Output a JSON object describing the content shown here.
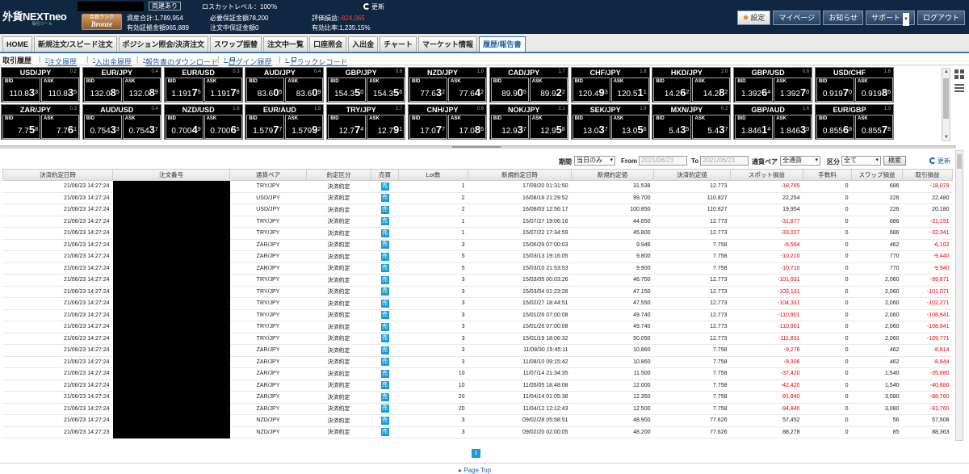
{
  "header": {
    "logo_text": "外貨NEXTneo",
    "logo_sub": "取引ツール",
    "one_click": "両建あり",
    "loss_cut": "ロスカットレベル：100％",
    "refresh": "更新",
    "rank_label": "会員ランク",
    "rank": "Bronze",
    "stats": {
      "total_assets": "資産合計:1,789,954",
      "valid_margin": "有効証拠金額965,889",
      "req_margin": "必要保証金額78,200",
      "order_margin": "注文中保証金額0",
      "eval_label": "評価損益:",
      "eval_value": "-824,065",
      "ratio": "有効比率:1,235.15%"
    },
    "buttons": {
      "settings": "設定",
      "mypage": "マイページ",
      "notice": "お知らせ",
      "support": "サポート",
      "logout": "ログアウト"
    }
  },
  "nav": {
    "tabs": [
      "HOME",
      "新規注文/スピード注文",
      "ポジション照会/決済注文",
      "スワップ振替",
      "注文中一覧",
      "口座照会",
      "入出金",
      "チャート",
      "マーケット情報",
      "履歴/報告書"
    ],
    "active": "履歴/報告書"
  },
  "subnav": {
    "items": [
      "取引履歴",
      "注文履歴",
      "入出金履歴",
      "報告書のダウンロード",
      "ログイン履歴",
      "トラックレコード"
    ]
  },
  "rate_labels": {
    "bid": "BID",
    "ask": "ASK"
  },
  "rates": [
    {
      "pair": "USD/JPY",
      "spread": "0.2",
      "bid": [
        "110.8",
        "3",
        "3"
      ],
      "ask": [
        "110.8",
        "3",
        "5"
      ]
    },
    {
      "pair": "EUR/JPY",
      "spread": "0.4",
      "bid": [
        "132.0",
        "8",
        "5"
      ],
      "ask": [
        "132.0",
        "8",
        "9"
      ]
    },
    {
      "pair": "EUR/USD",
      "spread": "0.3",
      "bid": [
        "1.191",
        "7",
        "5"
      ],
      "ask": [
        "1.191",
        "7",
        "8"
      ]
    },
    {
      "pair": "AUD/JPY",
      "spread": "0.4",
      "bid": [
        "83.6",
        "0",
        "5"
      ],
      "ask": [
        "83.6",
        "0",
        "9"
      ]
    },
    {
      "pair": "GBP/JPY",
      "spread": "0.6",
      "bid": [
        "154.3",
        "5",
        "0"
      ],
      "ask": [
        "154.3",
        "5",
        "6"
      ]
    },
    {
      "pair": "NZD/JPY",
      "spread": "1.0",
      "bid": [
        "77.6",
        "3",
        "2"
      ],
      "ask": [
        "77.6",
        "4",
        "2"
      ]
    },
    {
      "pair": "CAD/JPY",
      "spread": "1.7",
      "bid": [
        "89.9",
        "0",
        "5"
      ],
      "ask": [
        "89.9",
        "2",
        "2"
      ]
    },
    {
      "pair": "CHF/JPY",
      "spread": "1.8",
      "bid": [
        "120.4",
        "9",
        "3"
      ],
      "ask": [
        "120.5",
        "1",
        "1"
      ]
    },
    {
      "pair": "HKD/JPY",
      "spread": "2.0",
      "bid": [
        "14.2",
        "6",
        "2"
      ],
      "ask": [
        "14.2",
        "8",
        "2"
      ]
    },
    {
      "pair": "GBP/USD",
      "spread": "0.6",
      "bid": [
        "1.392",
        "6",
        "4"
      ],
      "ask": [
        "1.392",
        "7",
        "0"
      ]
    },
    {
      "pair": "USD/CHF",
      "spread": "1.6",
      "bid": [
        "0.919",
        "7",
        "0"
      ],
      "ask": [
        "0.919",
        "8",
        "6"
      ]
    },
    {
      "pair": "ZAR/JPY",
      "spread": "0.3",
      "bid": [
        "7.7",
        "5",
        "8"
      ],
      "ask": [
        "7.7",
        "6",
        "1"
      ]
    },
    {
      "pair": "AUD/USD",
      "spread": "0.4",
      "bid": [
        "0.754",
        "3",
        "3"
      ],
      "ask": [
        "0.754",
        "3",
        "7"
      ]
    },
    {
      "pair": "NZD/USD",
      "spread": "1.6",
      "bid": [
        "0.700",
        "4",
        "9"
      ],
      "ask": [
        "0.700",
        "6",
        "5"
      ]
    },
    {
      "pair": "EUR/AUD",
      "spread": "1.5",
      "bid": [
        "1.579",
        "7",
        "7"
      ],
      "ask": [
        "1.579",
        "9",
        "2"
      ]
    },
    {
      "pair": "TRY/JPY",
      "spread": "1.7",
      "bid": [
        "12.7",
        "7",
        "4"
      ],
      "ask": [
        "12.7",
        "9",
        "1"
      ]
    },
    {
      "pair": "CNH/JPY",
      "spread": "0.9",
      "bid": [
        "17.0",
        "7",
        "7"
      ],
      "ask": [
        "17.0",
        "8",
        "6"
      ]
    },
    {
      "pair": "NOK/JPY",
      "spread": "2.1",
      "bid": [
        "12.9",
        "3",
        "7"
      ],
      "ask": [
        "12.9",
        "5",
        "8"
      ]
    },
    {
      "pair": "SEK/JPY",
      "spread": "1.9",
      "bid": [
        "13.0",
        "3",
        "7"
      ],
      "ask": [
        "13.0",
        "5",
        "6"
      ]
    },
    {
      "pair": "MXN/JPY",
      "spread": "0.2",
      "bid": [
        "5.4",
        "3",
        "5"
      ],
      "ask": [
        "5.4",
        "3",
        "7"
      ]
    },
    {
      "pair": "GBP/AUD",
      "spread": "1.6",
      "bid": [
        "1.846",
        "1",
        "4"
      ],
      "ask": [
        "1.846",
        "3",
        "0"
      ]
    },
    {
      "pair": "EUR/GBP",
      "spread": "1.0",
      "bid": [
        "0.855",
        "6",
        "8"
      ],
      "ask": [
        "0.855",
        "7",
        "8"
      ]
    }
  ],
  "filters": {
    "period_label": "期間",
    "period_value": "当日のみ",
    "from_label": "From",
    "from_value": "2021/06/23",
    "to_label": "To",
    "to_value": "2021/06/23",
    "pair_label": "通貨ペア",
    "pair_value": "全通貨",
    "type_label": "区分",
    "type_value": "全て",
    "search": "検索",
    "refresh": "更新"
  },
  "table": {
    "headers": [
      "決済約定日時",
      "注文番号",
      "通貨ペア",
      "約定区分",
      "売買",
      "Lot数",
      "新規約定日時",
      "新規約定値",
      "決済約定値",
      "スポット損益",
      "手数料",
      "スワップ損益",
      "取引損益"
    ],
    "side_text": "売",
    "rows": [
      [
        "21/06/23 14:27:24",
        "TRY/JPY",
        "決済約定",
        "1",
        "17/09/20 01:31:50",
        "31.538",
        "12.773",
        "-18,765",
        "0",
        "686",
        "-18,079"
      ],
      [
        "21/06/23 14:27:24",
        "USD/JPY",
        "決済約定",
        "2",
        "16/08/16 21:29:52",
        "99.700",
        "110.827",
        "22,254",
        "0",
        "226",
        "22,480"
      ],
      [
        "21/06/23 14:27:24",
        "USD/JPY",
        "決済約定",
        "2",
        "16/08/03 12:56:17",
        "100.850",
        "110.827",
        "19,954",
        "0",
        "226",
        "20,180"
      ],
      [
        "21/06/23 14:27:24",
        "TRY/JPY",
        "決済約定",
        "1",
        "15/07/27 19:06:16",
        "44.650",
        "12.773",
        "-31,877",
        "0",
        "686",
        "-31,191"
      ],
      [
        "21/06/23 14:27:24",
        "TRY/JPY",
        "決済約定",
        "1",
        "15/07/22 17:34:59",
        "45.800",
        "12.773",
        "-33,027",
        "0",
        "686",
        "-32,341"
      ],
      [
        "21/06/23 14:27:24",
        "ZAR/JPY",
        "決済約定",
        "3",
        "15/06/29 07:00:03",
        "9.946",
        "7.758",
        "-6,564",
        "0",
        "462",
        "-6,102"
      ],
      [
        "21/06/23 14:27:24",
        "ZAR/JPY",
        "決済約定",
        "5",
        "15/03/13 19:16:05",
        "9.800",
        "7.758",
        "-10,210",
        "0",
        "770",
        "-9,440"
      ],
      [
        "21/06/23 14:27:24",
        "ZAR/JPY",
        "決済約定",
        "5",
        "15/03/10 21:53:53",
        "9.900",
        "7.758",
        "-10,710",
        "0",
        "770",
        "-9,940"
      ],
      [
        "21/06/23 14:27:24",
        "TRY/JPY",
        "決済約定",
        "3",
        "15/03/05 00:03:26",
        "46.750",
        "12.773",
        "-101,931",
        "0",
        "2,060",
        "-99,871"
      ],
      [
        "21/06/23 14:27:24",
        "TRY/JPY",
        "決済約定",
        "3",
        "15/03/04 01:23:28",
        "47.150",
        "12.773",
        "-103,131",
        "0",
        "2,060",
        "-101,071"
      ],
      [
        "21/06/23 14:27:24",
        "TRY/JPY",
        "決済約定",
        "3",
        "15/02/27 18:44:51",
        "47.550",
        "12.773",
        "-104,331",
        "0",
        "2,060",
        "-102,271"
      ],
      [
        "21/06/23 14:27:24",
        "TRY/JPY",
        "決済約定",
        "3",
        "15/01/26 07:00:08",
        "49.740",
        "12.773",
        "-110,901",
        "0",
        "2,060",
        "-108,841"
      ],
      [
        "21/06/23 14:27:24",
        "TRY/JPY",
        "決済約定",
        "3",
        "15/01/26 07:00:08",
        "49.740",
        "12.773",
        "-110,901",
        "0",
        "2,060",
        "-108,841"
      ],
      [
        "21/06/23 14:27:24",
        "TRY/JPY",
        "決済約定",
        "3",
        "15/01/19 18:06:32",
        "50.050",
        "12.773",
        "-111,831",
        "0",
        "2,060",
        "-109,771"
      ],
      [
        "21/06/23 14:27:24",
        "ZAR/JPY",
        "決済約定",
        "3",
        "11/08/30 15:45:11",
        "10.860",
        "7.758",
        "-9,276",
        "0",
        "462",
        "-8,814"
      ],
      [
        "21/06/23 14:27:24",
        "ZAR/JPY",
        "決済約定",
        "3",
        "11/08/10 09:15:42",
        "10.860",
        "7.758",
        "-9,306",
        "0",
        "462",
        "-8,844"
      ],
      [
        "21/06/23 14:27:24",
        "ZAR/JPY",
        "決済約定",
        "10",
        "11/07/14 21:34:35",
        "11.500",
        "7.758",
        "-37,420",
        "0",
        "1,540",
        "-35,880"
      ],
      [
        "21/06/23 14:27:24",
        "ZAR/JPY",
        "決済約定",
        "10",
        "11/05/05 18:48:08",
        "12.000",
        "7.758",
        "-42,420",
        "0",
        "1,540",
        "-40,880"
      ],
      [
        "21/06/23 14:27:24",
        "ZAR/JPY",
        "決済約定",
        "20",
        "11/04/14 01:05:38",
        "12.350",
        "7.758",
        "-91,840",
        "0",
        "3,080",
        "-88,760"
      ],
      [
        "21/06/23 14:27:24",
        "ZAR/JPY",
        "決済約定",
        "20",
        "11/04/12 12:12:43",
        "12.500",
        "7.758",
        "-94,840",
        "0",
        "3,080",
        "-91,760"
      ],
      [
        "21/06/23 14:27:24",
        "NZD/JPY",
        "決済約定",
        "3",
        "09/02/28 05:58:51",
        "48.900",
        "77.626",
        "57,452",
        "0",
        "56",
        "57,508"
      ],
      [
        "21/06/23 14:27:23",
        "NZD/JPY",
        "決済約定",
        "3",
        "09/02/20 02:00:05",
        "48.200",
        "77.626",
        "88,278",
        "0",
        "85",
        "88,363"
      ]
    ]
  },
  "pager": {
    "current": "1"
  },
  "footer": {
    "page_top": "Page Top"
  }
}
